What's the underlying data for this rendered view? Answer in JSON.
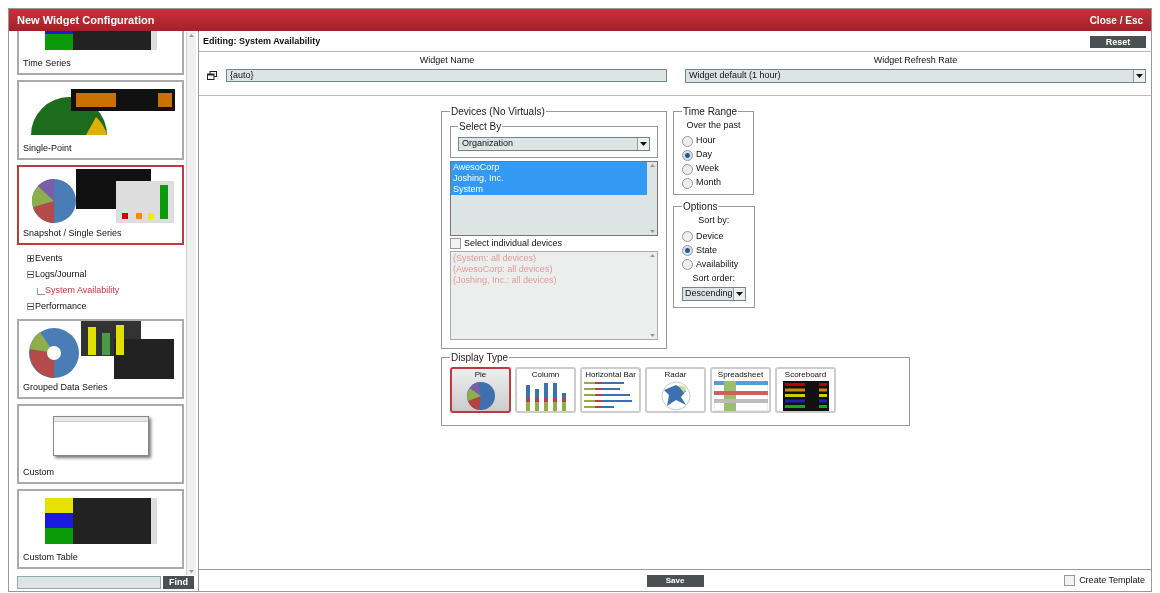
{
  "window": {
    "title": "New Widget Configuration",
    "close": "Close / Esc"
  },
  "sidebar": {
    "cards": [
      {
        "label": "Time Series",
        "kind": "time-series",
        "selected": false
      },
      {
        "label": "Single-Point",
        "kind": "single-point",
        "selected": false
      },
      {
        "label": "Snapshot / Single Series",
        "kind": "snapshot",
        "selected": true
      },
      {
        "label": "Grouped Data Series",
        "kind": "grouped",
        "selected": false
      },
      {
        "label": "Custom",
        "kind": "custom",
        "selected": false
      },
      {
        "label": "Custom Table",
        "kind": "custom-table",
        "selected": false
      }
    ],
    "tree": [
      {
        "label": "Events",
        "expanded": false
      },
      {
        "label": "Logs/Journal",
        "expanded": true,
        "children": [
          {
            "label": "System Availability",
            "selected": true
          }
        ]
      },
      {
        "label": "Performance",
        "expanded": true
      }
    ],
    "find": {
      "button": "Find"
    }
  },
  "editor": {
    "title": "Editing: System Availability",
    "reset": "Reset",
    "widget_name": {
      "label": "Widget Name",
      "value": "{auto}"
    },
    "refresh_rate": {
      "label": "Widget Refresh Rate",
      "value": "Widget default (1 hour)"
    }
  },
  "devices": {
    "legend": "Devices (No Virtuals)",
    "select_by": {
      "legend": "Select By",
      "value": "Organization"
    },
    "organizations": [
      {
        "label": "AwesoCorp",
        "selected": true
      },
      {
        "label": "Joshing, Inc.",
        "selected": true
      },
      {
        "label": "System",
        "selected": true
      }
    ],
    "individual": {
      "label": "Select individual devices",
      "checked": false
    },
    "device_list": {
      "disabled": true,
      "items": [
        "(System: all devices)",
        "(AwesoCorp: all devices)",
        "(Joshing, Inc.: all devices)"
      ]
    }
  },
  "time_range": {
    "legend": "Time Range",
    "caption": "Over the past",
    "options": [
      {
        "label": "Hour",
        "selected": false
      },
      {
        "label": "Day",
        "selected": true
      },
      {
        "label": "Week",
        "selected": false
      },
      {
        "label": "Month",
        "selected": false
      }
    ]
  },
  "options": {
    "legend": "Options",
    "sort_by": "Sort by:",
    "sort_options": [
      {
        "label": "Device",
        "selected": false
      },
      {
        "label": "State",
        "selected": true
      },
      {
        "label": "Availability",
        "selected": false
      }
    ],
    "sort_order_label": "Sort order:",
    "sort_order": "Descending"
  },
  "display_type": {
    "legend": "Display Type",
    "types": [
      {
        "label": "Pie",
        "kind": "pie",
        "selected": true
      },
      {
        "label": "Column",
        "kind": "column",
        "selected": false
      },
      {
        "label": "Horizontal Bar",
        "kind": "hbar",
        "selected": false
      },
      {
        "label": "Radar",
        "kind": "radar",
        "selected": false
      },
      {
        "label": "Spreadsheet",
        "kind": "spreadsheet",
        "selected": false
      },
      {
        "label": "Scoreboard",
        "kind": "scoreboard",
        "selected": false
      }
    ]
  },
  "footer": {
    "save": "Save",
    "create_template": {
      "label": "Create Template",
      "checked": false
    }
  }
}
